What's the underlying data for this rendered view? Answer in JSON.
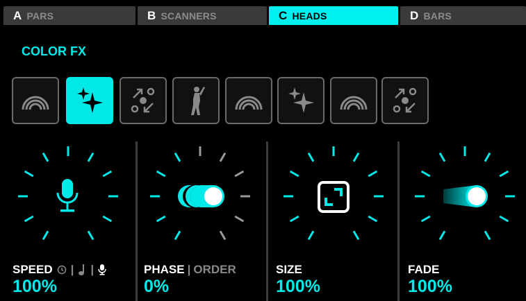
{
  "tabs": [
    {
      "letter": "A",
      "label": "PARS",
      "active": false
    },
    {
      "letter": "B",
      "label": "SCANNERS",
      "active": false
    },
    {
      "letter": "C",
      "label": "HEADS",
      "active": true
    },
    {
      "letter": "D",
      "label": "BARS",
      "active": false
    }
  ],
  "section_title": "COLOR FX",
  "fx_buttons": [
    {
      "icon": "rainbow-icon",
      "active": false
    },
    {
      "icon": "sparkle-icon",
      "active": true
    },
    {
      "icon": "scatter-arrows-icon",
      "active": false
    },
    {
      "icon": "dancer-icon",
      "active": false
    },
    {
      "icon": "rainbow-icon",
      "active": false
    },
    {
      "icon": "sparkle-icon",
      "active": false
    },
    {
      "icon": "rainbow-icon",
      "active": false
    },
    {
      "icon": "scatter-arrows-icon",
      "active": false
    }
  ],
  "knobs": {
    "speed": {
      "label": "SPEED",
      "modes": [
        "clock-icon",
        "music-note-icon",
        "microphone-icon"
      ],
      "selected_mode": "microphone-icon",
      "value": "100%",
      "center_icon": "microphone-icon"
    },
    "phase": {
      "label": "PHASE",
      "label_alt": "ORDER",
      "value": "0%",
      "center_icon": "phase-toggle-icon"
    },
    "size": {
      "label": "SIZE",
      "value": "100%",
      "center_icon": "expand-icon"
    },
    "fade": {
      "label": "FADE",
      "value": "100%",
      "center_icon": "fade-toggle-icon"
    }
  },
  "colors": {
    "accent": "#00eaea",
    "tab_inactive_bg": "#3a3a3a",
    "tick_inactive": "#9a9a9a",
    "background": "#000000"
  }
}
